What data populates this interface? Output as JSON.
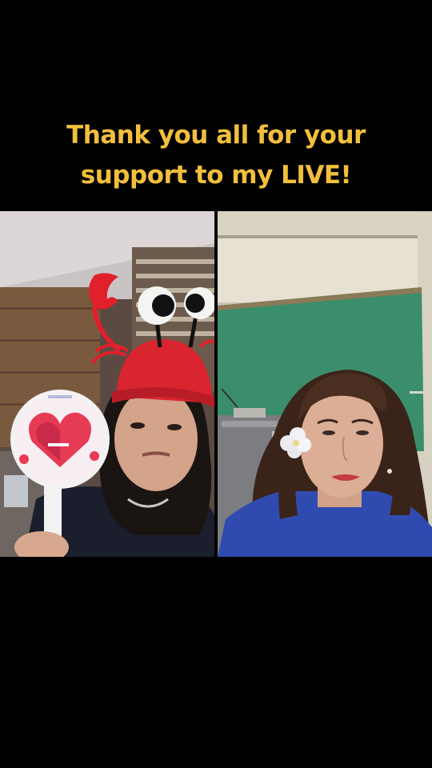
{
  "caption": {
    "line1": "Thank you all for your",
    "line2": "support to my LIVE!"
  },
  "colors": {
    "background": "#000000",
    "caption_text": "#f2bf3c",
    "divider": "#000000"
  },
  "layout_description": {
    "left_feed": "Host wearing a red crab hat with googly eyes, holding a heart-shaped fan sign",
    "right_feed": "Guest with long brown hair and a white flower, sitting in front of a green wall"
  }
}
